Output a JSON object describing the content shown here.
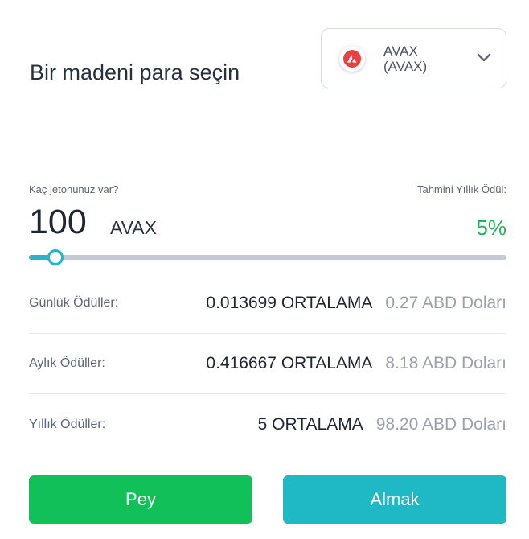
{
  "heading": "Bir madeni para seçin",
  "coin_select": {
    "icon": "avalanche-logo-icon",
    "name_line1": "AVAX",
    "name_line2": "(AVAX)",
    "chevron": "chevron-down-icon"
  },
  "holdings": {
    "label": "Kaç jetonunuz var?",
    "amount": "100",
    "unit": "AVAX",
    "slider_fraction": 0.055
  },
  "estimated_reward": {
    "label": "Tahmini Yıllık Ödül:",
    "value": "5%"
  },
  "rewards": [
    {
      "label": "Günlük Ödüller:",
      "coin_value": "0.013699 ORTALAMA",
      "usd_value": "0.27 ABD Doları"
    },
    {
      "label": "Aylık Ödüller:",
      "coin_value": "0.416667 ORTALAMA",
      "usd_value": "8.18 ABD Doları"
    },
    {
      "label": "Yıllık Ödüller:",
      "coin_value": "5 ORTALAMA",
      "usd_value": "98.20 ABD Doları"
    }
  ],
  "buttons": {
    "buy_label": "Pey",
    "sell_label": "Almak"
  },
  "colors": {
    "accent_teal": "#1fb8c5",
    "buy_green": "#12c05a",
    "reward_green": "#20b559",
    "avax_red": "#e84142"
  }
}
